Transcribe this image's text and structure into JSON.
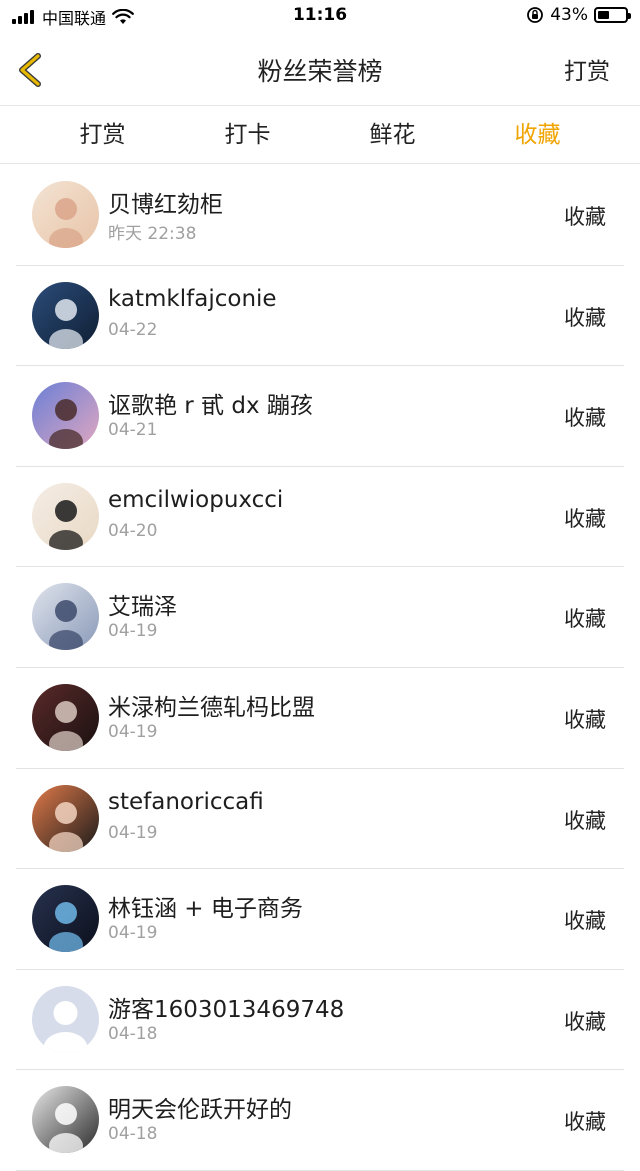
{
  "status_bar": {
    "carrier": "中国联通",
    "time": "11:16",
    "battery": "43%",
    "battery_level": 0.43
  },
  "nav": {
    "title": "粉丝荣誉榜",
    "right_action": "打赏",
    "back_icon": "chevron-left-icon"
  },
  "tabs": [
    {
      "label": "打赏",
      "active": false
    },
    {
      "label": "打卡",
      "active": false
    },
    {
      "label": "鲜花",
      "active": false
    },
    {
      "label": "收藏",
      "active": true
    }
  ],
  "colors": {
    "accent": "#f0a400",
    "back_icon": "#e6b800"
  },
  "fans": [
    {
      "name": "贝博红劾柜",
      "date": "昨天 22:38",
      "action": "收藏",
      "avatar": {
        "bg1": "#f3e3d3",
        "bg2": "#e8c4a8",
        "fg": "#d9a58a"
      }
    },
    {
      "name": "katmklfajconie",
      "date": "04-22",
      "action": "收藏",
      "avatar": {
        "bg1": "#2b4c7a",
        "bg2": "#0f1f33",
        "fg": "#dfe6ee"
      }
    },
    {
      "name": "讴歌艳 r 甙 dx 蹦孩",
      "date": "04-21",
      "action": "收藏",
      "avatar": {
        "bg1": "#6b7fd6",
        "bg2": "#e0a7c0",
        "fg": "#4a2c2a"
      }
    },
    {
      "name": "emcilwiopuxcci",
      "date": "04-20",
      "action": "收藏",
      "avatar": {
        "bg1": "#f4ede6",
        "bg2": "#e9d9c4",
        "fg": "#1a1a1a"
      }
    },
    {
      "name": "艾瑞泽",
      "date": "04-19",
      "action": "收藏",
      "avatar": {
        "bg1": "#dfe3ec",
        "bg2": "#8a9ab8",
        "fg": "#3d4a6b"
      }
    },
    {
      "name": "米渌枸兰德轧杩比盟",
      "date": "04-19",
      "action": "收藏",
      "avatar": {
        "bg1": "#5a2a2a",
        "bg2": "#1a1010",
        "fg": "#d8c8c0"
      }
    },
    {
      "name": "stefanoriccafi",
      "date": "04-19",
      "action": "收藏",
      "avatar": {
        "bg1": "#e07a4a",
        "bg2": "#1a1a1a",
        "fg": "#f2d3c0"
      }
    },
    {
      "name": "林钰涵 + 电子商务",
      "date": "04-19",
      "action": "收藏",
      "avatar": {
        "bg1": "#27324f",
        "bg2": "#0c0f1c",
        "fg": "#6fb7e8"
      }
    },
    {
      "name": "游客1603013469748",
      "date": "04-18",
      "action": "收藏",
      "avatar": {
        "bg1": "#d7dcea",
        "bg2": "#c9d0e2",
        "fg": "#ffffff"
      }
    },
    {
      "name": "明天会伦跃开好的",
      "date": "04-18",
      "action": "收藏",
      "avatar": {
        "bg1": "#e8e8e8",
        "bg2": "#2a2a2a",
        "fg": "#ffffff"
      }
    }
  ]
}
